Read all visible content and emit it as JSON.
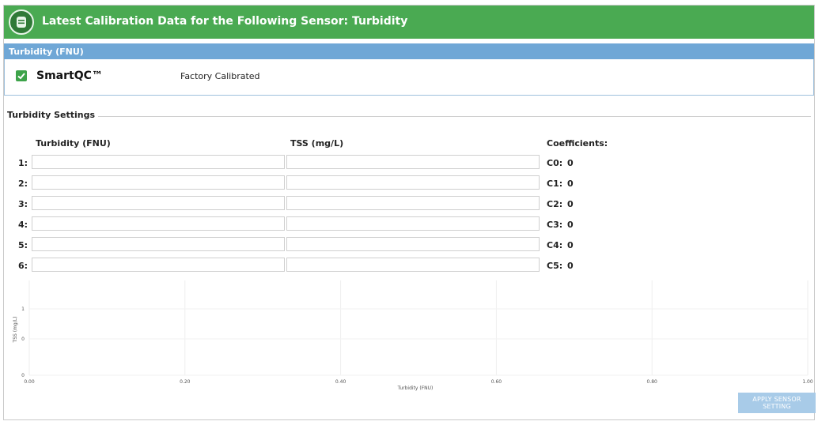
{
  "header": {
    "title": "Latest Calibration Data for the Following Sensor:  Turbidity"
  },
  "section": {
    "label": "Turbidity (FNU)"
  },
  "smartqc": {
    "name": "SmartQC™",
    "checked": true,
    "status": "Factory Calibrated"
  },
  "settings": {
    "legend": "Turbidity Settings",
    "columns": {
      "turbidity": "Turbidity (FNU)",
      "tss": "TSS (mg/L)",
      "coefficients": "Coefficients:"
    },
    "rows": [
      {
        "label": "1:",
        "turbidity": "",
        "tss": "",
        "coef_label": "C0:",
        "coef_value": "0"
      },
      {
        "label": "2:",
        "turbidity": "",
        "tss": "",
        "coef_label": "C1:",
        "coef_value": "0"
      },
      {
        "label": "3:",
        "turbidity": "",
        "tss": "",
        "coef_label": "C2:",
        "coef_value": "0"
      },
      {
        "label": "4:",
        "turbidity": "",
        "tss": "",
        "coef_label": "C3:",
        "coef_value": "0"
      },
      {
        "label": "5:",
        "turbidity": "",
        "tss": "",
        "coef_label": "C4:",
        "coef_value": "0"
      },
      {
        "label": "6:",
        "turbidity": "",
        "tss": "",
        "coef_label": "C5:",
        "coef_value": "0"
      }
    ]
  },
  "chart_data": {
    "type": "scatter",
    "xlabel": "Turbidity (FNU)",
    "ylabel": "TSS (mg/L)",
    "xlim": [
      0,
      1
    ],
    "x_ticks": [
      "0.00",
      "0.20",
      "0.40",
      "0.60",
      "0.80",
      "1.00"
    ],
    "y_ticks": [
      "0",
      "0",
      "1"
    ],
    "series": [],
    "grid": true
  },
  "actions": {
    "apply_label": "APPLY SENSOR SETTING"
  },
  "colors": {
    "header_green": "#4aaa52",
    "section_blue": "#6fa7d6",
    "button_blue": "#a8cbe8",
    "check_green": "#3da34a"
  }
}
